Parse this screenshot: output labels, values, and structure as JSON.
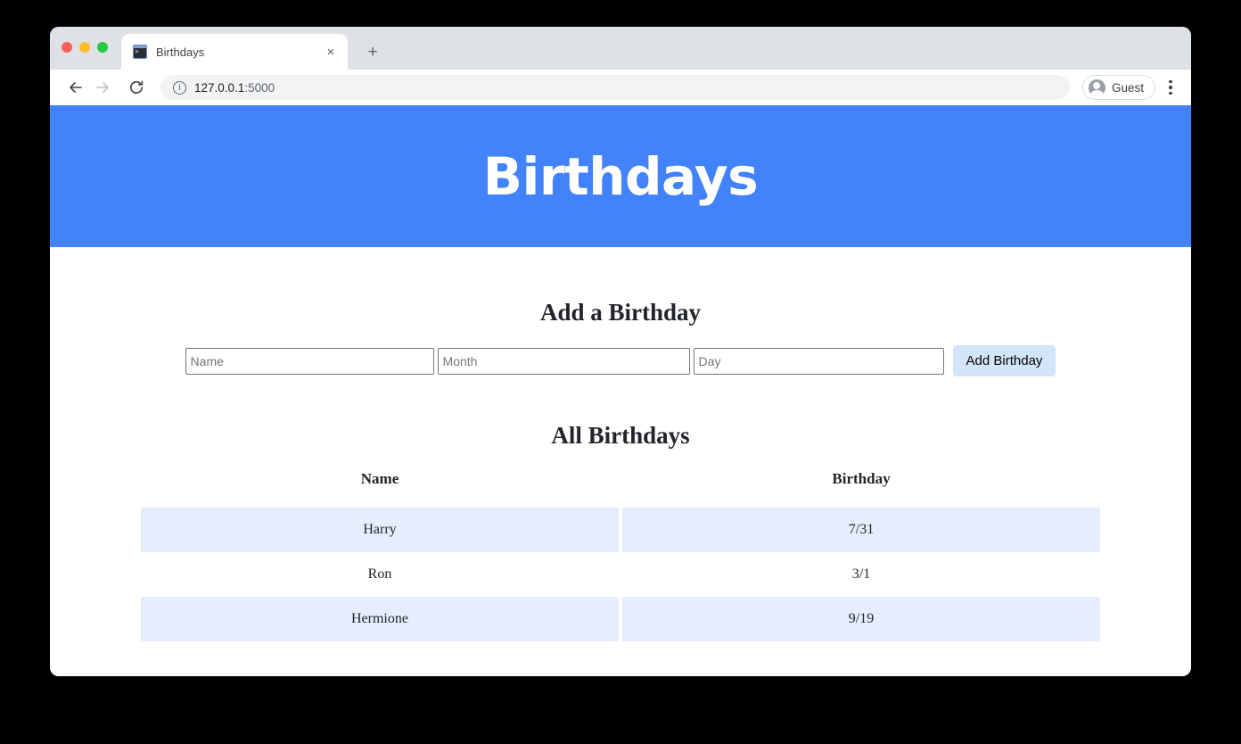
{
  "browser": {
    "tab": {
      "title": "Birthdays",
      "favicon_name": "terminal-icon",
      "close_glyph": "×"
    },
    "new_tab_glyph": "+",
    "nav": {
      "back_glyph": "←",
      "forward_glyph": "→",
      "reload_glyph": "↻"
    },
    "omnibox": {
      "url_host": "127.0.0.1",
      "url_port": ":5000",
      "info_icon_name": "site-info-icon"
    },
    "profile": {
      "label": "Guest"
    },
    "colors": {
      "tabstrip": "#dee1e6",
      "omnibox": "#f1f3f4"
    }
  },
  "page": {
    "header": {
      "title": "Birthdays",
      "background": "#4282fb",
      "text_color": "#ffffff"
    },
    "add_section": {
      "heading": "Add a Birthday",
      "fields": [
        {
          "name": "name",
          "placeholder": "Name",
          "value": ""
        },
        {
          "name": "month",
          "placeholder": "Month",
          "value": ""
        },
        {
          "name": "day",
          "placeholder": "Day",
          "value": ""
        }
      ],
      "submit_label": "Add Birthday",
      "submit_color": "#d3e6f9"
    },
    "list_section": {
      "heading": "All Birthdays",
      "columns": [
        "Name",
        "Birthday"
      ],
      "rows": [
        {
          "name": "Harry",
          "birthday": "7/31"
        },
        {
          "name": "Ron",
          "birthday": "3/1"
        },
        {
          "name": "Hermione",
          "birthday": "9/19"
        }
      ],
      "stripe_color": "#e6eefd"
    }
  }
}
